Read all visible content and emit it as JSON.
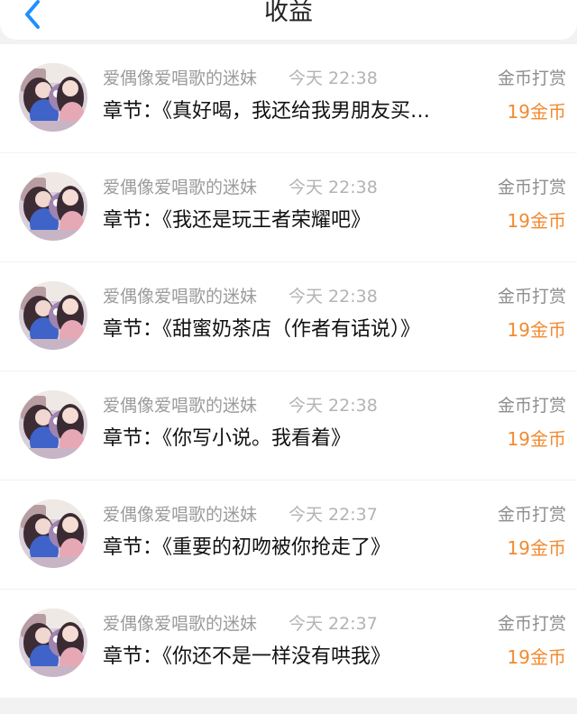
{
  "header": {
    "title": "收益",
    "back_icon": "chevron-left-icon"
  },
  "colors": {
    "accent_blue": "#1f8fff",
    "amount_orange": "#f28a2f",
    "background": "#f2f2f2"
  },
  "records": [
    {
      "user": "爱偶像爱唱歌的迷妹",
      "time": "今天 22:38",
      "type": "金币打赏",
      "chapter": "章节：《真好喝，我还给我男朋友买…",
      "amount": "19金币"
    },
    {
      "user": "爱偶像爱唱歌的迷妹",
      "time": "今天 22:38",
      "type": "金币打赏",
      "chapter": "章节：《我还是玩王者荣耀吧》",
      "amount": "19金币"
    },
    {
      "user": "爱偶像爱唱歌的迷妹",
      "time": "今天 22:38",
      "type": "金币打赏",
      "chapter": "章节：《甜蜜奶茶店（作者有话说）》",
      "amount": "19金币"
    },
    {
      "user": "爱偶像爱唱歌的迷妹",
      "time": "今天 22:38",
      "type": "金币打赏",
      "chapter": "章节：《你写小说。我看着》",
      "amount": "19金币"
    },
    {
      "user": "爱偶像爱唱歌的迷妹",
      "time": "今天 22:37",
      "type": "金币打赏",
      "chapter": "章节：《重要的初吻被你抢走了》",
      "amount": "19金币"
    },
    {
      "user": "爱偶像爱唱歌的迷妹",
      "time": "今天 22:37",
      "type": "金币打赏",
      "chapter": "章节：《你还不是一样没有哄我》",
      "amount": "19金币"
    }
  ]
}
